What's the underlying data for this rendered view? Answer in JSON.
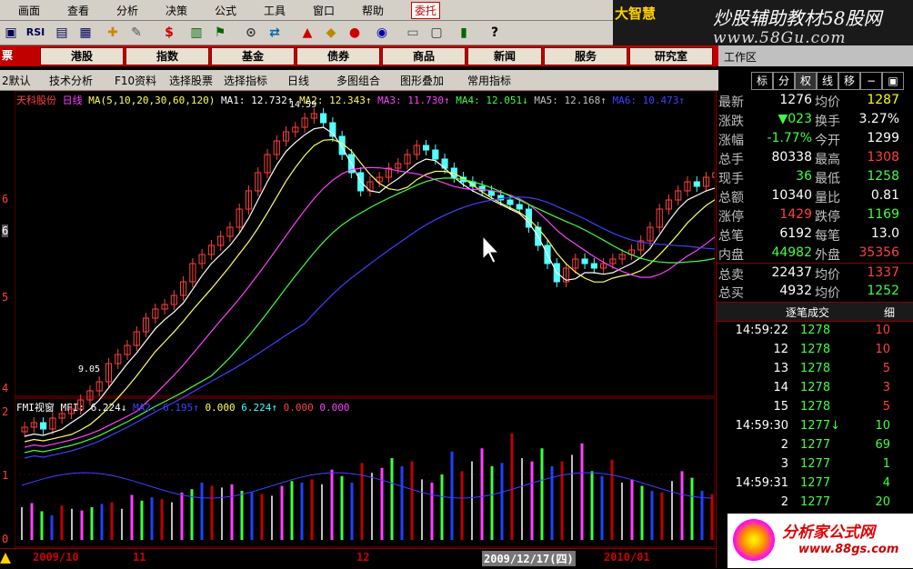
{
  "menu": [
    "画面",
    "查看",
    "分析",
    "决策",
    "公式",
    "工具",
    "窗口",
    "帮助",
    "委托"
  ],
  "brand": {
    "logo": "大智慧",
    "title": "炒股辅助教材58股网",
    "url": "www.58Gu.com"
  },
  "funcbar": [
    "票",
    "港股",
    "指数",
    "基金",
    "债券",
    "商品",
    "新闻",
    "服务",
    "研究室"
  ],
  "workarea": "工作区",
  "tabstrip": [
    "2默认",
    "技术分析",
    "F10资料",
    "选择股票",
    "选择指标",
    "日线",
    "多图组合",
    "图形叠加",
    "常用指标"
  ],
  "rtabs": [
    "标",
    "分",
    "权",
    "线",
    "移"
  ],
  "chart": {
    "header": {
      "name": "天科股份",
      "period": "日线",
      "ma": "MA(5,10,20,30,60,120)",
      "ma1": "MA1: 12.732↑",
      "ma2": "MA2: 12.343↑",
      "ma3": "MA3: 11.730↑",
      "ma4": "MA4: 12.051↓",
      "ma5": "MA5: 12.168↑",
      "ma6": "MA6: 10.473↑"
    },
    "high_label": "14.59",
    "low_label": "9.05",
    "y_ticks": [
      "6",
      "6",
      "5",
      "4"
    ],
    "ind_header": {
      "name": "FMI视窗",
      "mfi": "MFI: 6.224↓",
      "a": "MA2: 6.195↑",
      "b": "0.000",
      "c": "6.224↑",
      "d": "0.000",
      "e": "0.000"
    },
    "ind_ticks": [
      "2",
      "1",
      "0"
    ],
    "colors": {
      "up": "#ff4040",
      "down": "#54ffff",
      "ma1": "#ffffff",
      "ma2": "#ffff60",
      "ma3": "#ff40ff",
      "ma4": "#40ff40",
      "ma5": "#c0c0c0",
      "ma6": "#4040ff"
    }
  },
  "dates": [
    "2009/10",
    "11",
    "12",
    "2009/12/17(四)",
    "2010/01"
  ],
  "quote": [
    {
      "l1": "最新",
      "v1": "1276",
      "l2": "均价",
      "v2": "1287",
      "c1": "#ffffff",
      "c2": "#ffff00"
    },
    {
      "l1": "涨跌",
      "v1": "▼023",
      "l2": "换手",
      "v2": "3.27%",
      "c1": "#40ff40",
      "c2": "#ffffff"
    },
    {
      "l1": "涨幅",
      "v1": "-1.77%",
      "l2": "今开",
      "v2": "1299",
      "c1": "#40ff40",
      "c2": "#ffffff"
    },
    {
      "l1": "总手",
      "v1": "80338",
      "l2": "最高",
      "v2": "1308",
      "c1": "#ffffff",
      "c2": "#ff4040"
    },
    {
      "l1": "现手",
      "v1": "36",
      "l2": "最低",
      "v2": "1258",
      "c1": "#40ff40",
      "c2": "#40ff40"
    },
    {
      "l1": "总额",
      "v1": "10340",
      "l2": "量比",
      "v2": "0.81",
      "c1": "#ffffff",
      "c2": "#ffffff"
    },
    {
      "l1": "涨停",
      "v1": "1429",
      "l2": "跌停",
      "v2": "1169",
      "c1": "#ff4040",
      "c2": "#40ff40"
    },
    {
      "l1": "总笔",
      "v1": "6192",
      "l2": "每笔",
      "v2": "13.0",
      "c1": "#ffffff",
      "c2": "#ffffff"
    },
    {
      "l1": "内盘",
      "v1": "44982",
      "l2": "外盘",
      "v2": "35356",
      "c1": "#40ff40",
      "c2": "#ff4040"
    },
    {
      "l1": "总卖",
      "v1": "22437",
      "l2": "均价",
      "v2": "1337",
      "c1": "#ffffff",
      "c2": "#ff4040"
    },
    {
      "l1": "总买",
      "v1": "4932",
      "l2": "均价",
      "v2": "1252",
      "c1": "#ffffff",
      "c2": "#40ff40"
    }
  ],
  "ticks_header": {
    "title": "逐笔成交",
    "right": "细"
  },
  "ticks": [
    {
      "t": "14:59:22",
      "p": "1278",
      "v": "10",
      "pc": "#40ff40",
      "vc": "#ff4040"
    },
    {
      "t": "12",
      "p": "1278",
      "v": "10",
      "pc": "#40ff40",
      "vc": "#ff4040"
    },
    {
      "t": "13",
      "p": "1278",
      "v": "5",
      "pc": "#40ff40",
      "vc": "#ff4040"
    },
    {
      "t": "14",
      "p": "1278",
      "v": "3",
      "pc": "#40ff40",
      "vc": "#ff4040"
    },
    {
      "t": "15",
      "p": "1278",
      "v": "5",
      "pc": "#40ff40",
      "vc": "#ff4040"
    },
    {
      "t": "14:59:30",
      "p": "1277↓",
      "v": "10",
      "pc": "#40ff40",
      "vc": "#40ff40"
    },
    {
      "t": "2",
      "p": "1277",
      "v": "69",
      "pc": "#40ff40",
      "vc": "#40ff40"
    },
    {
      "t": "3",
      "p": "1277",
      "v": "1",
      "pc": "#40ff40",
      "vc": "#40ff40"
    },
    {
      "t": "14:59:31",
      "p": "1277",
      "v": "4",
      "pc": "#40ff40",
      "vc": "#40ff40"
    },
    {
      "t": "2",
      "p": "1277",
      "v": "20",
      "pc": "#40ff40",
      "vc": "#40ff40"
    }
  ],
  "watermark": {
    "title": "分析家公式网",
    "url": "www.88gs.com"
  }
}
